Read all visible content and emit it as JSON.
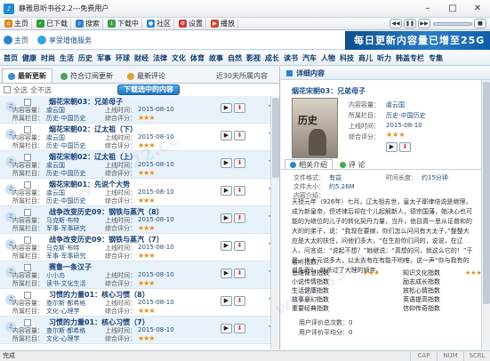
{
  "window": {
    "title": "静雅思听书谷2.2---免费用户",
    "app_icon": "app-logo-icon"
  },
  "toolbar": {
    "buttons": [
      {
        "label": "主页",
        "icon": "home-icon",
        "color": "#e08a1f"
      },
      {
        "label": "已下载",
        "icon": "download-done-icon",
        "color": "#2d9b3a"
      },
      {
        "label": "搜索",
        "icon": "search-icon",
        "color": "#2c83d1"
      },
      {
        "label": "下载中",
        "icon": "downloading-icon",
        "color": "#3aa04a"
      },
      {
        "label": "社区",
        "icon": "community-icon",
        "color": "#1f8bd6"
      },
      {
        "label": "设置",
        "icon": "settings-icon",
        "color": "#d23b3b"
      },
      {
        "label": "播放",
        "icon": "play-icon",
        "color": "#d6452a"
      }
    ]
  },
  "nav": {
    "home": "主页",
    "vip": "享受增值服务",
    "banner": "每日更新内容量已增至25G"
  },
  "categories": [
    "首页",
    "健康",
    "时尚",
    "生活",
    "历史",
    "军事",
    "环球",
    "财经",
    "法律",
    "文化",
    "体育",
    "故事",
    "自然",
    "影视",
    "成长",
    "读书",
    "汽车",
    "人物",
    "科技",
    "商儿",
    "听力",
    "韩盖专栏",
    "专集"
  ],
  "left": {
    "tabs": {
      "latest": "最新更新",
      "eligible": "符合订阅更新",
      "reviews": "最新评论",
      "recent": "近30天所属内容"
    },
    "select_all": "全选",
    "select_none": "全不选",
    "download_selected": "下载选中的内容",
    "field_labels": {
      "content": "内容容量：",
      "category": "所属栏目：",
      "date": "上线时间：",
      "rating": "综合评分："
    },
    "items": [
      {
        "title": "烟花宋朝03：兄弟母子",
        "content": "虞云国",
        "category": "历史-中国历史",
        "date": "2015-08-10",
        "stars": "★★★"
      },
      {
        "title": "烟花宋朝02：辽太祖（下）",
        "content": "虞云国",
        "category": "历史-中国历史",
        "date": "2015-08-10",
        "stars": "★★★"
      },
      {
        "title": "烟花宋朝02：辽太祖（上）",
        "content": "虞云国",
        "category": "历史-中国历史",
        "date": "2015-08-10",
        "stars": "★★★"
      },
      {
        "title": "烟花宋朝01：先说个大势",
        "content": "虞云国",
        "category": "历史-中国历史",
        "date": "2015-08-10",
        "stars": "★★★"
      },
      {
        "title": "战争改变历史09：钢铁与蒸汽（8）",
        "content": "马克斯·布特",
        "category": "军事-军事研究",
        "date": "2015-08-10",
        "stars": "★★★"
      },
      {
        "title": "战争改变历史09：钢铁与蒸汽（7）",
        "content": "马克斯·布特",
        "category": "军事-军事研究",
        "date": "2015-08-10",
        "stars": "★★★"
      },
      {
        "title": "赛鲁一条汉子",
        "content": "小小鸟",
        "category": "读书-文化生活",
        "date": "2015-08-10",
        "stars": "★★★"
      },
      {
        "title": "习惯的力量01：核心习惯（8）",
        "content": "查尔斯·都希格",
        "category": "文化-心理学",
        "date": "2015-08-10",
        "stars": "★★★"
      },
      {
        "title": "习惯的力量01：核心习惯（7）",
        "content": "查尔斯·都希格",
        "category": "文化-心理学",
        "date": "2015-08-10",
        "stars": "★★★"
      }
    ]
  },
  "detail": {
    "header": "详细内容",
    "title": "烟花宋朝03：兄弟母子",
    "cover_text": "历史",
    "content_label": "内容容量：",
    "content_value": "虞云国",
    "category_label": "所属栏目：",
    "category_value": "历史-中国历史",
    "date_label": "上线时间：",
    "date_value": "2015-08-10",
    "rating_label": "综合评分：",
    "stars": "★★★",
    "tab_intro": "相关介绍",
    "tab_comment": "评 论",
    "format_label": "文件格式：",
    "format_value": "有益",
    "duration_label": "时间长度：",
    "duration_value": "约15分钟",
    "size_label": "文件大小：",
    "size_value": "约5.26M",
    "intro_label": "内容介绍：",
    "description": "天授元年（926年）七月，辽太祖去世，皇太子耶律倍说是继理，成为新皇帝，但述律后却在个儿起解新人，德宗国藩，她决心也可能的为继位的儿子的转化契丹力量，当升，他目真一思从证普和的大的的弟子，说：“我现在要嫁，你们怎么问问有大太子，”整整大应是大太的扶住，问他们多大，“在生前你们问的，说说，在辽人，问言说：“说起不想？”她继说：“真想的问，就这么它的！”于是，许大元说多大，以太去有在有能不哟唯，说一声“你与我有的说先而”，就杀过了大理的嫡年。",
    "ratings_header": "收听指数：",
    "ratings": [
      {
        "name": "思维智慧指数",
        "stars": "★★★",
        "name2": "知识文化指数",
        "stars2": "★★★"
      },
      {
        "name": "小说传情指数",
        "stars": "",
        "name2": "励志成长指数",
        "stars2": ""
      },
      {
        "name": "生活健康指数",
        "stars": "",
        "name2": "放松心情指数",
        "stars2": ""
      },
      {
        "name": "故事悬幻指数",
        "stars": "",
        "name2": "英语提高指数",
        "stars2": ""
      },
      {
        "name": "重要经典指数",
        "stars": "",
        "name2": "信仰传奇指数",
        "stars2": ""
      }
    ],
    "total_label": "用户评价总次数：",
    "total_value": "0",
    "avg_label": "用户评价平均分：",
    "avg_value": "0"
  },
  "statusbar": {
    "text": "完成",
    "caps": "CAP",
    "num": "NUM",
    "scrl": "SCRL"
  },
  "watermark": "www.3322.cc"
}
